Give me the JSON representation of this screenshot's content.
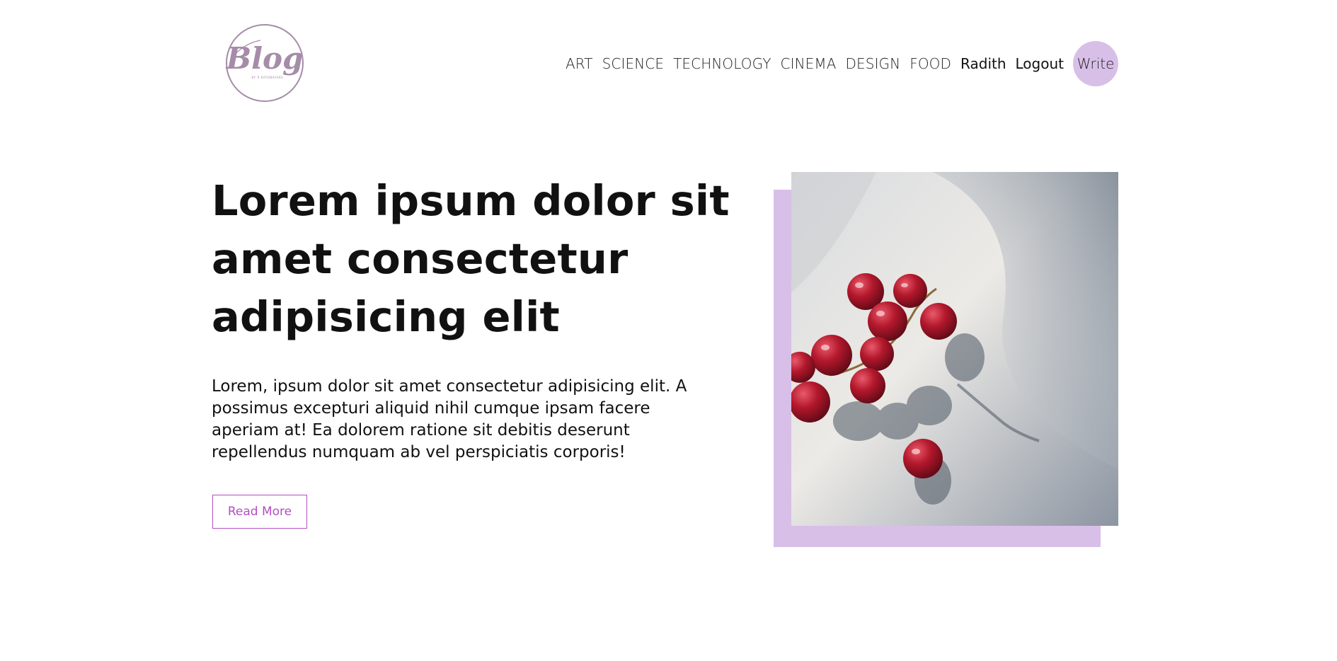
{
  "header": {
    "logo": {
      "text": "Blog",
      "subtext": "BY R.RATHNAYAKE",
      "color": "#a58ca8"
    },
    "nav": {
      "categories": [
        "ART",
        "SCIENCE",
        "TECHNOLOGY",
        "CINEMA",
        "DESIGN",
        "FOOD"
      ],
      "user": "Radith",
      "logout": "Logout",
      "write": "Write"
    }
  },
  "hero": {
    "title": "Lorem ipsum dolor sit amet consectetur adipisicing elit",
    "description": "Lorem, ipsum dolor sit amet consectetur adipisicing elit. A possimus excepturi aliquid nihil cumque ipsam facere aperiam at! Ea dolorem ratione sit debitis deserunt repellendus numquam ab vel perspiciatis corporis!",
    "button": "Read More",
    "image": {
      "subject": "grapes-photo"
    }
  },
  "colors": {
    "accent": "#d8bfe8",
    "button_text": "#b24fc0",
    "text": "#111111"
  }
}
